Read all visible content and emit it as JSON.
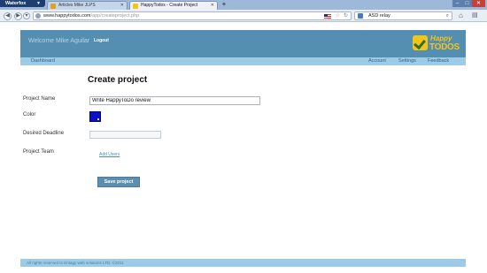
{
  "browser": {
    "app_menu_label": "Waterfox",
    "tabs": [
      {
        "label": "Articles Mike JLPS",
        "active": false
      },
      {
        "label": "HappyTodos - Create Project",
        "active": true
      }
    ],
    "url_host": "www.happytodos.com",
    "url_path": "/app/createproject.php",
    "search_query": "ASD relay",
    "new_tab": "+",
    "icons": {
      "back": "back-arrow-icon",
      "forward": "forward-arrow-icon",
      "refresh": "refresh-icon",
      "star": "star-icon",
      "home": "home-icon",
      "search": "search-icon"
    }
  },
  "header": {
    "welcome_text": "Welcome Mike Aguilar",
    "logout_label": "Logout",
    "logo_word1": "Happy",
    "logo_word2": "TODOS"
  },
  "nav": {
    "dashboard": "Dashboard",
    "account": "Account",
    "settings": "Settings",
    "feedback": "Feedback"
  },
  "form": {
    "title": "Create project",
    "project_name_label": "Project Name",
    "project_name_value": "Write HappyToDo review",
    "color_label": "Color",
    "color_value": "#0b0fc9",
    "deadline_label": "Desired Deadline",
    "deadline_value": "",
    "team_label": "Project Team",
    "add_users_label": "Add Users",
    "save_label": "Save project"
  },
  "footer": {
    "text": "All rights reserved to Entagy web solutions LTD. ©2011"
  },
  "colors": {
    "header_bg": "#548eb1",
    "nav_bg": "#9ccbe5",
    "button_bg": "#5d8eae",
    "logo_yellow": "#f2c618"
  }
}
